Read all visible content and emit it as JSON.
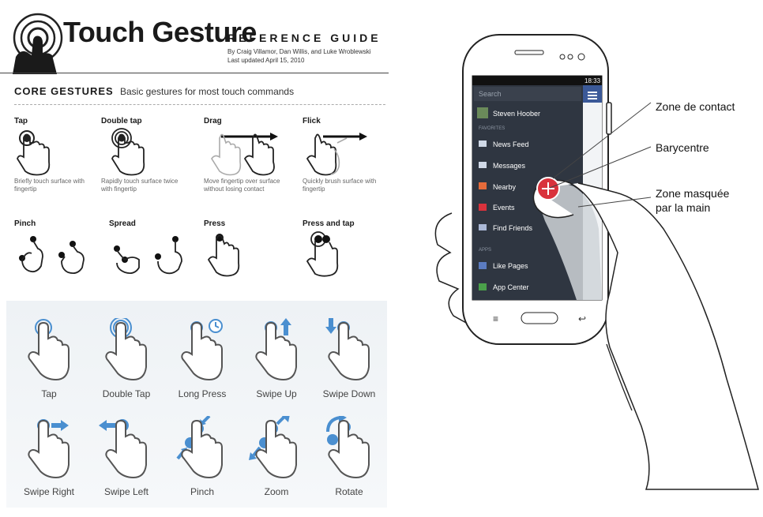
{
  "guide": {
    "title": "Touch Gesture",
    "subtitle": "REFERENCE GUIDE",
    "byline": "By Craig Villamor, Dan Willis, and Luke Wroblewski",
    "updated": "Last updated April 15, 2010",
    "core_heading": "CORE GESTURES",
    "core_sub": "Basic gestures for most touch commands",
    "gestures": [
      {
        "name": "Tap",
        "desc": "Briefly touch surface with fingertip"
      },
      {
        "name": "Double tap",
        "desc": "Rapidly touch surface twice with fingertip"
      },
      {
        "name": "Drag",
        "desc": "Move fingertip over surface without losing contact"
      },
      {
        "name": "Flick",
        "desc": "Quickly brush surface with fingertip"
      },
      {
        "name": "Pinch",
        "desc": ""
      },
      {
        "name": "Spread",
        "desc": ""
      },
      {
        "name": "Press",
        "desc": ""
      },
      {
        "name": "Press and tap",
        "desc": ""
      }
    ]
  },
  "icon_grid": {
    "accent": "#4a8fd0",
    "labels": [
      "Tap",
      "Double Tap",
      "Long Press",
      "Swipe Up",
      "Swipe Down",
      "Swipe Right",
      "Swipe Left",
      "Pinch",
      "Zoom",
      "Rotate"
    ]
  },
  "phone": {
    "status_time": "18:33",
    "search_placeholder": "Search",
    "user": "Steven Hoober",
    "favorites_header": "FAVORITES",
    "apps_header": "APPS",
    "menu": [
      "News Feed",
      "Messages",
      "Nearby",
      "Events",
      "Find Friends"
    ],
    "apps": [
      "Like Pages",
      "App Center"
    ],
    "callouts": [
      "Zone de contact",
      "Barycentre",
      "Zone masquée",
      "par la main"
    ],
    "accent": "#d9323c",
    "drawer_bg": "#2f3641"
  }
}
